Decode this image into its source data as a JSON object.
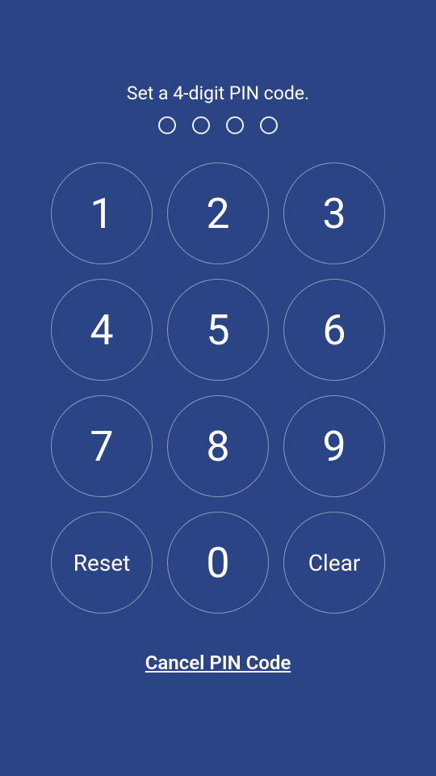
{
  "title": "Set a 4-digit PIN code.",
  "pin_progress": {
    "total": 4,
    "filled": 0
  },
  "keypad": {
    "key_1": "1",
    "key_2": "2",
    "key_3": "3",
    "key_4": "4",
    "key_5": "5",
    "key_6": "6",
    "key_7": "7",
    "key_8": "8",
    "key_9": "9",
    "key_0": "0",
    "reset_label": "Reset",
    "clear_label": "Clear"
  },
  "footer": {
    "cancel_label": "Cancel PIN Code"
  },
  "colors": {
    "background": "#2a4486",
    "text": "#ffffff",
    "key_border": "rgba(255,255,255,0.45)"
  }
}
